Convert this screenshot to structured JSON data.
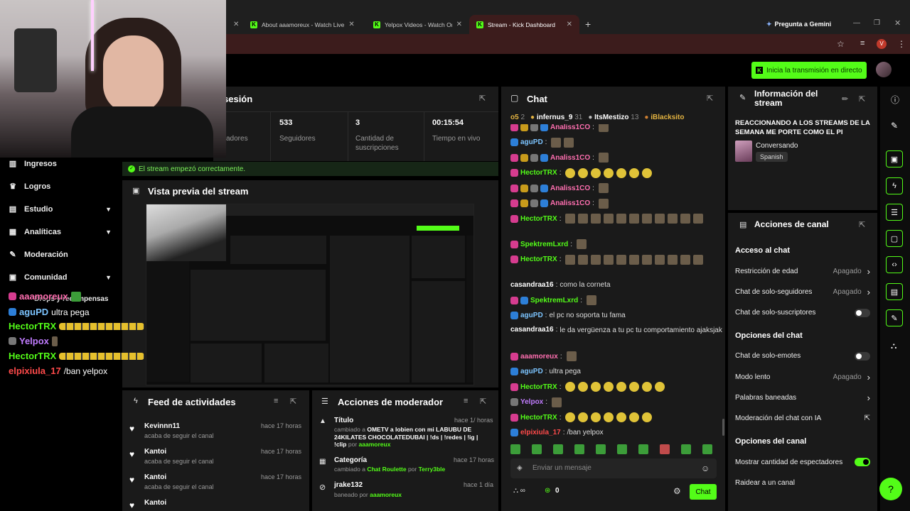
{
  "browser": {
    "tabs": [
      {
        "label": "About aaamoreux - Watch Live"
      },
      {
        "label": "Yelpox Videos - Watch On-Dem"
      },
      {
        "label": "Stream - Kick Dashboard"
      }
    ],
    "add_tab": "+",
    "gemini": "Pregunta a Gemini",
    "profile_initial": "V"
  },
  "header": {
    "start_stream": "Inicia la transmisión en directo"
  },
  "session": {
    "title_fragment": "sesión",
    "stats": [
      {
        "value": "",
        "label": "adores"
      },
      {
        "value": "533",
        "label": "Seguidores"
      },
      {
        "value": "3",
        "label": "Cantidad de suscripciones"
      },
      {
        "value": "00:15:54",
        "label": "Tiempo en vivo"
      }
    ],
    "status": "El stream empezó correctamente."
  },
  "preview": {
    "title": "Vista previa del stream"
  },
  "sidebar": {
    "items": [
      {
        "label": "Ingresos",
        "icon": "chart-icon",
        "chevron": false
      },
      {
        "label": "Logros",
        "icon": "trophy-icon",
        "chevron": false
      },
      {
        "label": "Estudio",
        "icon": "studio-icon",
        "chevron": true
      },
      {
        "label": "Analíticas",
        "icon": "analytics-icon",
        "chevron": true
      },
      {
        "label": "Moderación",
        "icon": "wrench-icon",
        "chevron": false
      },
      {
        "label": "Comunidad",
        "icon": "community-icon",
        "chevron": true
      },
      {
        "label": "Drops y recompensas",
        "icon": "gift-icon",
        "chevron": false
      }
    ]
  },
  "overlay_chat": [
    {
      "user": "aaamoreux",
      "text": "",
      "color": "#ff6fb0"
    },
    {
      "user": "aguPD",
      "text": "ultra pega",
      "color": "#7cc4ff"
    },
    {
      "user": "HectorTRX",
      "text": "",
      "color": "#53fc18"
    },
    {
      "user": "Yelpox",
      "text": "",
      "color": "#c17cff"
    },
    {
      "user": "HectorTRX",
      "text": "",
      "color": "#53fc18"
    },
    {
      "user": "elpixiula_17",
      "text": "/ban yelpox",
      "color": "#ff4a4a"
    }
  ],
  "feed": {
    "title": "Feed de actividades",
    "items": [
      {
        "name": "Kevinnn11",
        "sub": "acaba de seguir el canal",
        "time": "hace 17 horas"
      },
      {
        "name": "Kantoi",
        "sub": "acaba de seguir el canal",
        "time": "hace 17 horas"
      },
      {
        "name": "Kantoi",
        "sub": "acaba de seguir el canal",
        "time": "hace 17 horas"
      },
      {
        "name": "Kantoi",
        "sub": "",
        "time": ""
      }
    ]
  },
  "mod_actions": {
    "title": "Acciones de moderador",
    "items": [
      {
        "name": "Título",
        "time": "hace 1/ horas",
        "line1": "cambiado a",
        "new_value": "OMETV a lobien con mi LABUBU DE 24KILATES CHOCOLATEDUBAI | !ds | !redes | !ig | !clip",
        "by_prefix": "por",
        "by": "aaamoreux"
      },
      {
        "name": "Categoría",
        "time": "hace 17 horas",
        "line1": "cambiado a",
        "new_value": "Chat Roulette",
        "by_prefix": "por",
        "by": "Terry3ble"
      },
      {
        "name": "jrake132",
        "time": "hace 1 día",
        "line1": "baneado por",
        "new_value": "",
        "by_prefix": "",
        "by": "aaamoreux"
      }
    ]
  },
  "chat": {
    "title": "Chat",
    "leaderboard": [
      {
        "name": "o5",
        "count": "2"
      },
      {
        "name": "infernus_9",
        "count": "31"
      },
      {
        "name": "ItsMestizo",
        "count": "13"
      },
      {
        "name": "iBlacksito",
        "count": ""
      }
    ],
    "messages": [
      {
        "user": "Analiss1CO",
        "text": "",
        "color": "n-pink",
        "badges": [
          "b-pink",
          "b-gold",
          "b-gray",
          "b-blue"
        ],
        "emotes": 1
      },
      {
        "user": "aguPD",
        "text": "",
        "color": "n-blue",
        "badges": [
          "b-blue"
        ],
        "emotes": 2
      },
      {
        "user": "Analiss1CO",
        "text": "",
        "color": "n-pink",
        "badges": [
          "b-pink",
          "b-gold",
          "b-gray",
          "b-blue"
        ],
        "emotes": 1
      },
      {
        "user": "HectorTRX",
        "text": "",
        "color": "n-green",
        "badges": [
          "b-pink"
        ],
        "emotes": 7
      },
      {
        "user": "Analiss1CO",
        "text": "",
        "color": "n-pink",
        "badges": [
          "b-pink",
          "b-gold",
          "b-gray",
          "b-blue"
        ],
        "emotes": 1
      },
      {
        "user": "Analiss1CO",
        "text": "",
        "color": "n-pink",
        "badges": [
          "b-pink",
          "b-gold",
          "b-gray",
          "b-blue"
        ],
        "emotes": 1
      },
      {
        "user": "HectorTRX",
        "text": "",
        "color": "n-green",
        "badges": [
          "b-pink"
        ],
        "emotes": 12
      },
      {
        "user": "SpektremLxrd",
        "text": "",
        "color": "n-green",
        "badges": [
          "b-pink"
        ],
        "emotes": 1
      },
      {
        "user": "HectorTRX",
        "text": "",
        "color": "n-green",
        "badges": [
          "b-pink"
        ],
        "emotes": 12
      },
      {
        "user": "casandraa16",
        "text": "como la corneta",
        "color": "n-white",
        "badges": [],
        "emotes": 0
      },
      {
        "user": "SpektremLxrd",
        "text": "",
        "color": "n-green",
        "badges": [
          "b-pink",
          "b-blue"
        ],
        "emotes": 1
      },
      {
        "user": "aguPD",
        "text": "el pc no soporta tu fama",
        "color": "n-blue",
        "badges": [
          "b-blue"
        ],
        "emotes": 0
      },
      {
        "user": "casandraa16",
        "text": "le da vergüenza a tu pc tu comportamiento ajaksjak",
        "color": "n-white",
        "badges": [],
        "emotes": 0
      },
      {
        "user": "aaamoreux",
        "text": "",
        "color": "n-pink",
        "badges": [
          "b-pink"
        ],
        "emotes": 1
      },
      {
        "user": "aguPD",
        "text": "ultra pega",
        "color": "n-blue",
        "badges": [
          "b-blue"
        ],
        "emotes": 0
      },
      {
        "user": "HectorTRX",
        "text": "",
        "color": "n-green",
        "badges": [
          "b-pink"
        ],
        "emotes": 8
      },
      {
        "user": "Yelpox",
        "text": "",
        "color": "n-purple",
        "badges": [
          "b-gray"
        ],
        "emotes": 1
      },
      {
        "user": "HectorTRX",
        "text": "",
        "color": "n-green",
        "badges": [
          "b-pink"
        ],
        "emotes": 7
      },
      {
        "user": "elpixiula_17",
        "text": "/ban yelpox",
        "color": "n-red",
        "badges": [
          "b-blue"
        ],
        "emotes": 0
      }
    ],
    "input_placeholder": "Enviar un mensaje",
    "points": "0",
    "send": "Chat"
  },
  "stream_info": {
    "title": "Información del stream",
    "stream_title": "REACCIONANDO A LOS STREAMS DE LA SEMANA ME PORTE COMO EL PI",
    "category": "Conversando",
    "language": "Spanish"
  },
  "channel_actions": {
    "title": "Acciones de canal",
    "sections": [
      {
        "heading": "Acceso al chat",
        "rows": [
          {
            "label": "Restricción de edad",
            "value": "Apagado",
            "kind": "chevron"
          },
          {
            "label": "Chat de solo-seguidores",
            "value": "Apagado",
            "kind": "chevron"
          },
          {
            "label": "Chat de solo-suscriptores",
            "value": "",
            "kind": "toggle-off"
          }
        ]
      },
      {
        "heading": "Opciones del chat",
        "rows": [
          {
            "label": "Chat de solo-emotes",
            "value": "",
            "kind": "toggle-off"
          },
          {
            "label": "Modo lento",
            "value": "Apagado",
            "kind": "chevron"
          },
          {
            "label": "Palabras baneadas",
            "value": "",
            "kind": "chevron"
          },
          {
            "label": "Moderación del chat con IA",
            "value": "",
            "kind": "external"
          }
        ]
      },
      {
        "heading": "Opciones del canal",
        "rows": [
          {
            "label": "Mostrar cantidad de espectadores",
            "value": "",
            "kind": "toggle-on"
          },
          {
            "label": "Raidear a un canal",
            "value": "",
            "kind": "none"
          }
        ]
      }
    ]
  },
  "colors": {
    "accent": "#53fc18",
    "panel": "#1a1a1a",
    "tab_active": "#3c1c1c"
  }
}
